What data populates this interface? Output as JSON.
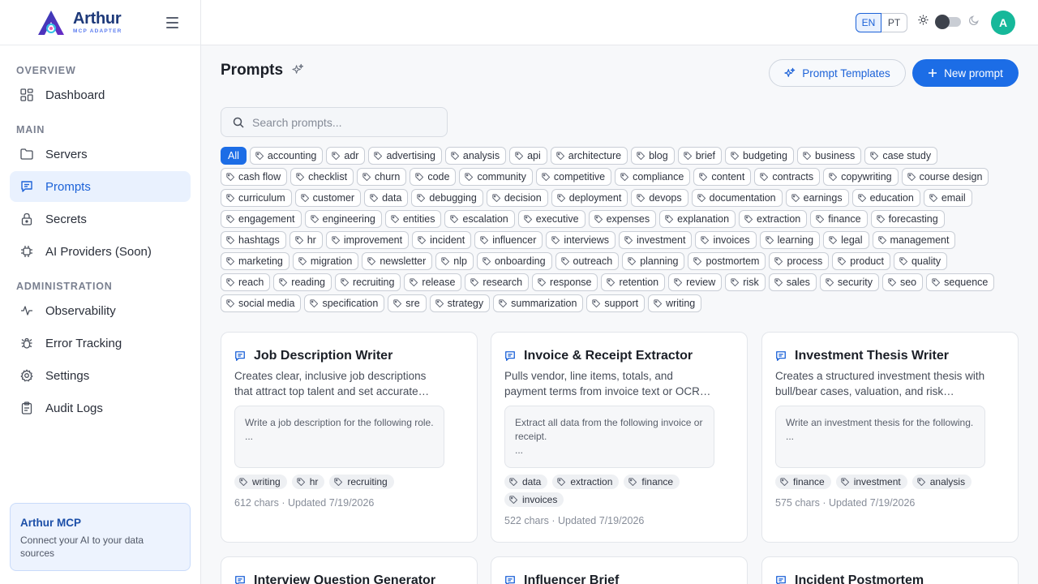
{
  "brand": {
    "name": "Arthur",
    "subtitle": "MCP ADAPTER"
  },
  "sidebar": {
    "sections": [
      "OVERVIEW",
      "MAIN",
      "ADMINISTRATION"
    ],
    "items": [
      {
        "label": "Dashboard",
        "icon": "dashboard-icon"
      },
      {
        "label": "Servers",
        "icon": "folder-icon"
      },
      {
        "label": "Prompts",
        "icon": "message-icon",
        "active": true
      },
      {
        "label": "Secrets",
        "icon": "lock-icon"
      },
      {
        "label": "AI Providers (Soon)",
        "icon": "chip-icon"
      },
      {
        "label": "Observability",
        "icon": "activity-icon"
      },
      {
        "label": "Error Tracking",
        "icon": "bug-icon"
      },
      {
        "label": "Settings",
        "icon": "gear-icon"
      },
      {
        "label": "Audit Logs",
        "icon": "clipboard-icon"
      }
    ],
    "promo": {
      "title": "Arthur MCP",
      "text": "Connect your AI to your data sources"
    }
  },
  "topbar": {
    "languages": [
      "EN",
      "PT"
    ],
    "selected_language": "EN",
    "theme": "light",
    "avatar_initial": "A",
    "avatar_color": "#16b89a"
  },
  "page": {
    "title": "Prompts",
    "templates_button": "Prompt Templates",
    "new_button": "New prompt",
    "search_placeholder": "Search prompts...",
    "accent": "#1c6de6"
  },
  "tags": [
    "All",
    "accounting",
    "adr",
    "advertising",
    "analysis",
    "api",
    "architecture",
    "blog",
    "brief",
    "budgeting",
    "business",
    "case study",
    "cash flow",
    "checklist",
    "churn",
    "code",
    "community",
    "competitive",
    "compliance",
    "content",
    "contracts",
    "copywriting",
    "course design",
    "curriculum",
    "customer",
    "data",
    "debugging",
    "decision",
    "deployment",
    "devops",
    "documentation",
    "earnings",
    "education",
    "email",
    "engagement",
    "engineering",
    "entities",
    "escalation",
    "executive",
    "expenses",
    "explanation",
    "extraction",
    "finance",
    "forecasting",
    "hashtags",
    "hr",
    "improvement",
    "incident",
    "influencer",
    "interviews",
    "investment",
    "invoices",
    "learning",
    "legal",
    "management",
    "marketing",
    "migration",
    "newsletter",
    "nlp",
    "onboarding",
    "outreach",
    "planning",
    "postmortem",
    "process",
    "product",
    "quality",
    "reach",
    "reading",
    "recruiting",
    "release",
    "research",
    "response",
    "retention",
    "review",
    "risk",
    "sales",
    "security",
    "seo",
    "sequence",
    "social media",
    "specification",
    "sre",
    "strategy",
    "summarization",
    "support",
    "writing"
  ],
  "selected_tag": "All",
  "cards": [
    {
      "title": "Job Description Writer",
      "description": "Creates clear, inclusive job descriptions that attract top talent and set accurate…",
      "preview_line1": "Write a job description for the following role.",
      "preview_line2": "...",
      "tags": [
        "writing",
        "hr",
        "recruiting"
      ],
      "meta": "612 chars · Updated 7/19/2026"
    },
    {
      "title": "Invoice & Receipt Extractor",
      "description": "Pulls vendor, line items, totals, and payment terms from invoice text or OCR…",
      "preview_line1": "Extract all data from the following invoice or receipt.",
      "preview_line2": "...",
      "tags": [
        "data",
        "extraction",
        "finance",
        "invoices"
      ],
      "meta": "522 chars · Updated 7/19/2026"
    },
    {
      "title": "Investment Thesis Writer",
      "description": "Creates a structured investment thesis with bull/bear cases, valuation, and risk…",
      "preview_line1": "Write an investment thesis for the following.",
      "preview_line2": "...",
      "tags": [
        "finance",
        "investment",
        "analysis"
      ],
      "meta": "575 chars · Updated 7/19/2026"
    },
    {
      "title": "Interview Question Generator"
    },
    {
      "title": "Influencer Brief"
    },
    {
      "title": "Incident Postmortem"
    }
  ]
}
